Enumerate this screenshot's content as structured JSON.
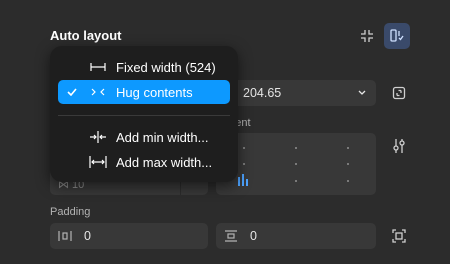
{
  "section": {
    "title": "Auto layout"
  },
  "height_field": {
    "value": "204.65"
  },
  "alignment": {
    "label": "nment"
  },
  "gap": {
    "text": "⋈ 10"
  },
  "padding": {
    "label": "Padding",
    "horizontal_value": "0",
    "vertical_value": "0"
  },
  "menu": {
    "items": [
      {
        "label": "Fixed width (524)",
        "icon": "fixed-width-icon",
        "selected": false
      },
      {
        "label": "Hug contents",
        "icon": "hug-contents-icon",
        "selected": true
      },
      {
        "label": "Add min width...",
        "icon": "min-width-icon",
        "selected": false
      },
      {
        "label": "Add max width...",
        "icon": "max-width-icon",
        "selected": false
      }
    ]
  },
  "colors": {
    "accent": "#0d99ff",
    "panel_bg": "#2c2c2c",
    "field_bg": "#383838",
    "menu_bg": "#1e1e1e",
    "active_toggle_bg": "#3a4a6a",
    "alignment_active": "#4da3ff"
  }
}
